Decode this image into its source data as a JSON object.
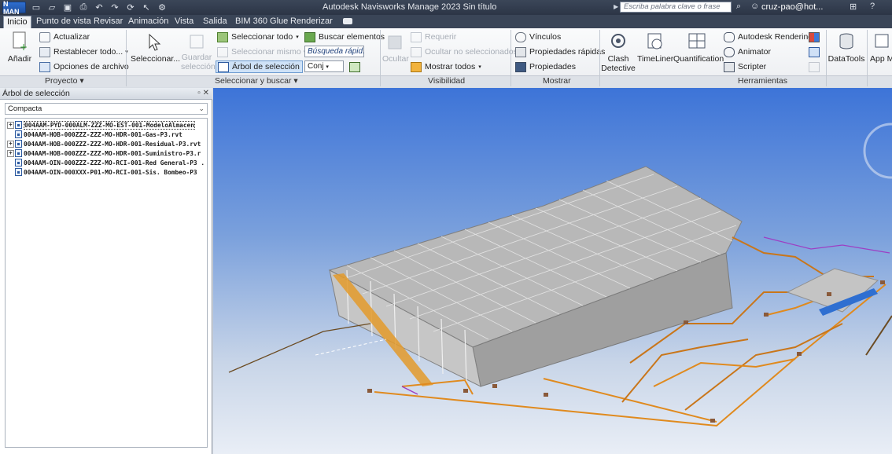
{
  "titlebar": {
    "app_badge": "N MAN",
    "title": "Autodesk Navisworks Manage 2023   Sin título",
    "search_placeholder": "Escriba palabra clave o frase",
    "user": "cruz-pao@hot...",
    "icons": [
      "new-icon",
      "open-icon",
      "save-icon",
      "print-icon",
      "undo-icon",
      "redo-icon",
      "refresh-icon",
      "select-icon",
      "options-icon",
      "binoculars-icon",
      "user-icon",
      "cart-icon",
      "help-icon"
    ]
  },
  "tabs": [
    "Inicio",
    "Punto de vista",
    "Revisar",
    "Animación",
    "Vista",
    "Salida",
    "BIM 360 Glue",
    "Renderizar"
  ],
  "ribbon": {
    "proyecto": {
      "anadir": "Añadir",
      "actualizar": "Actualizar",
      "restablecer": "Restablecer todo...",
      "opciones": "Opciones de archivo",
      "label": "Proyecto"
    },
    "seleccionar": {
      "seleccionar": "Seleccionar...",
      "guardar_line1": "Guardar",
      "guardar_line2": "selección",
      "seleccionar_todo": "Seleccionar todo",
      "seleccionar_mismo": "Seleccionar mismo",
      "arbol": "Árbol de selección",
      "buscar": "Buscar elementos",
      "busqueda_rapida": "Búsqueda rápid.",
      "conj": "Conj",
      "label": "Seleccionar y buscar"
    },
    "visibilidad": {
      "ocultar": "Ocultar",
      "requerir": "Requerir",
      "ocultar_no_sel": "Ocultar no seleccionados",
      "mostrar_todos": "Mostrar todos",
      "label": "Visibilidad"
    },
    "mostrar": {
      "vinculos": "Vínculos",
      "propiedades_rapidas": "Propiedades rápidas",
      "propiedades": "Propiedades",
      "label": "Mostrar"
    },
    "herramientas": {
      "clash_line1": "Clash",
      "clash_line2": "Detective",
      "timeliner": "TimeLiner",
      "quantification": "Quantification",
      "rendering": "Autodesk Rendering",
      "animator": "Animator",
      "scripter": "Scripter",
      "label": "Herramientas"
    },
    "datatools": "DataTools",
    "appm": "App M"
  },
  "panel": {
    "title": "Árbol de selección",
    "controls": "▫ ✕",
    "combo_value": "Compacta",
    "tree_items": [
      {
        "label": "004AAM-PYD-000ALM-ZZZ-MO-EST-001-ModeloAlmacen",
        "expandable": true
      },
      {
        "label": "004AAM-HOB-000ZZZ-ZZZ-MO-HDR-001-Gas-P3.rvt",
        "expandable": false
      },
      {
        "label": "004AAM-HOB-000ZZZ-ZZZ-MO-HDR-001-Residual-P3.rvt",
        "expandable": true
      },
      {
        "label": "004AAM-HOB-000ZZZ-ZZZ-MO-HDR-001-Suministro-P3.r",
        "expandable": true
      },
      {
        "label": "004AAM-OIN-000ZZZ-ZZZ-MO-RCI-001-Red General-P3 .",
        "expandable": false
      },
      {
        "label": "004AAM-OIN-000XXX-P01-MO-RCI-001-Sis. Bombeo-P3",
        "expandable": false
      }
    ]
  },
  "colors": {
    "titlebar": "#2c3546",
    "tab_row": "#3a4557",
    "selection_highlight": "#cfe2f7",
    "viewport_top": "#3d74d8",
    "viewport_bottom": "#e9eef6",
    "pipe_orange": "#e08a1e",
    "building_gray": "#a3a3a3"
  }
}
